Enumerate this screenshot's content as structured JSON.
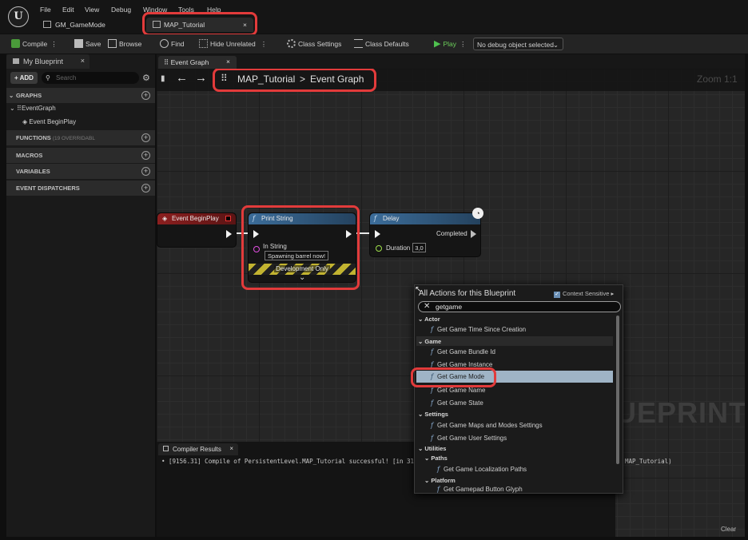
{
  "app": {
    "logo": "U",
    "menu": [
      "File",
      "Edit",
      "View",
      "Debug",
      "Window",
      "Tools",
      "Help"
    ]
  },
  "doc_tabs": [
    {
      "label": "GM_GameMode",
      "active": false
    },
    {
      "label": "MAP_Tutorial",
      "active": true,
      "close": "×"
    }
  ],
  "toolbar": {
    "compile": "Compile",
    "save": "Save",
    "browse": "Browse",
    "find": "Find",
    "hide_unrelated": "Hide Unrelated",
    "class_settings": "Class Settings",
    "class_defaults": "Class Defaults",
    "play": "Play",
    "debug_object": "No debug object selected"
  },
  "left_panel": {
    "tab": "My Blueprint",
    "close": "×",
    "add": "+ ADD",
    "search_placeholder": "Search",
    "graphs": "GRAPHS",
    "event_graph": "EventGraph",
    "event_begin_play": "Event BeginPlay",
    "functions": "FUNCTIONS",
    "functions_count": "(19 OVERRIDABL",
    "macros": "MACROS",
    "variables": "VARIABLES",
    "event_dispatchers": "EVENT DISPATCHERS"
  },
  "graph": {
    "tab": "Event Graph",
    "close": "×",
    "breadcrumb_root": "MAP_Tutorial",
    "breadcrumb_sep": ">",
    "breadcrumb_leaf": "Event Graph",
    "zoom": "Zoom 1:1",
    "watermark": "UEPRINT"
  },
  "nodes": {
    "begin_play": {
      "title": "Event BeginPlay"
    },
    "print_string": {
      "title": "Print String",
      "in_string_label": "In String",
      "in_string_value": "Spawning barrel now!",
      "dev_only": "Development Only"
    },
    "delay": {
      "title": "Delay",
      "completed": "Completed",
      "duration_label": "Duration",
      "duration_value": "3,0"
    }
  },
  "action_menu": {
    "title": "All Actions for this Blueprint",
    "context_sensitive": "Context Sensitive",
    "search_value": "getgame",
    "groups": [
      {
        "name": "Actor",
        "items": [
          "Get Game Time Since Creation"
        ]
      },
      {
        "name": "Game",
        "items": [
          "Get Game Bundle Id",
          "Get Game Instance",
          "Get Game Mode",
          "Get Game Name",
          "Get Game State"
        ]
      },
      {
        "name": "Settings",
        "items": [
          "Get Game Maps and Modes Settings",
          "Get Game User Settings"
        ]
      },
      {
        "name": "Utilities",
        "sub": [
          {
            "name": "Paths",
            "items": [
              "Get Game Localization Paths"
            ]
          },
          {
            "name": "Platform",
            "items": [
              "Get Gamepad Button Glyph"
            ]
          }
        ]
      }
    ],
    "selected": "Get Game Mode"
  },
  "compiler": {
    "tab": "Compiler Results",
    "close": "×",
    "message": "• [9156.31] Compile of PersistentLevel.MAP_Tutorial successful! [in 31",
    "message_tail": "MAP_Tutorial)",
    "clear": "Clear"
  },
  "colors": {
    "event_red": "#8c1f1f",
    "function_blue": "#3c6d9a",
    "highlight": "#e23b3b",
    "selected_row": "#9fb4c6"
  }
}
